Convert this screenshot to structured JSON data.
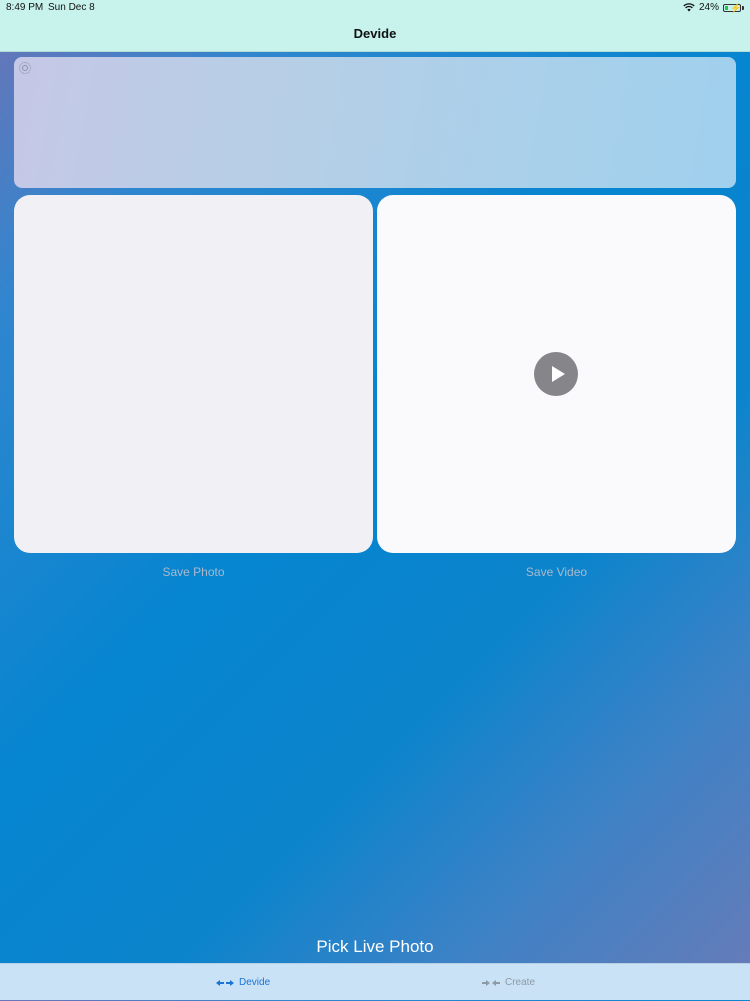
{
  "status_bar": {
    "time": "8:49 PM",
    "date": "Sun Dec 8",
    "battery_percent": "24%",
    "wifi_icon": "wifi-icon",
    "battery_icon": "battery-charging-icon",
    "battery_level": 0.24
  },
  "nav": {
    "title": "Devide"
  },
  "live_banner": {
    "icon": "live-photo-icon"
  },
  "photo_panel": {
    "save_label": "Save Photo"
  },
  "video_panel": {
    "play_icon": "play-icon",
    "save_label": "Save Video"
  },
  "pick_button": {
    "label": "Pick Live Photo"
  },
  "tabs": [
    {
      "label": "Devide",
      "icon": "arrows-apart-icon",
      "selected": true
    },
    {
      "label": "Create",
      "icon": "arrows-together-icon",
      "selected": false
    }
  ],
  "colors": {
    "accent": "#1a74d6",
    "nav_background": "#c8f3ec",
    "tab_bar_background": "#c9e2f6",
    "tab_inactive": "#8f9aa6",
    "play_button": "#86868a"
  }
}
